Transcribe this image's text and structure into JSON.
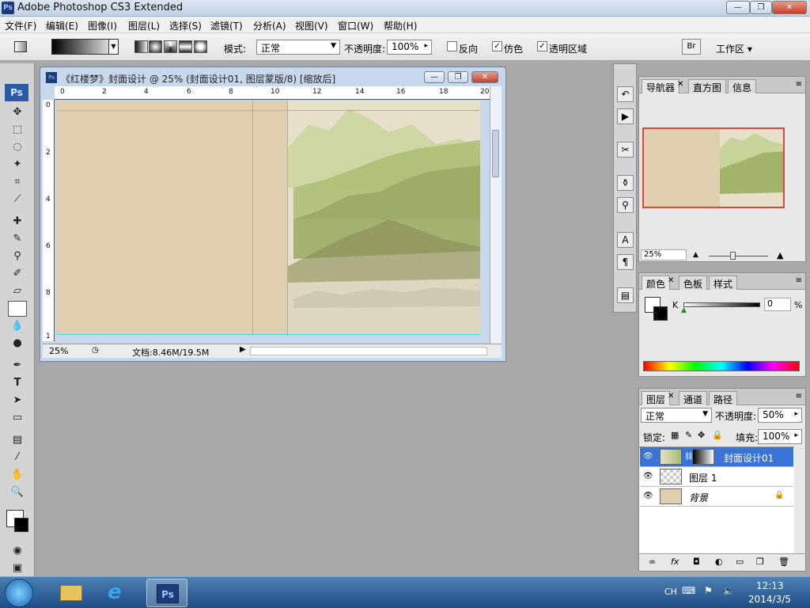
{
  "app": {
    "title": "Adobe Photoshop CS3 Extended",
    "icon_text": "Ps"
  },
  "window_controls": {
    "minimize": "—",
    "maximize": "❐",
    "close": "✕"
  },
  "menu": [
    "文件(F)",
    "编辑(E)",
    "图像(I)",
    "图层(L)",
    "选择(S)",
    "滤镜(T)",
    "分析(A)",
    "视图(V)",
    "窗口(W)",
    "帮助(H)"
  ],
  "options": {
    "mode_label": "模式:",
    "mode_value": "正常",
    "opacity_label": "不透明度:",
    "opacity_value": "100%",
    "reverse_label": "反向",
    "reverse_checked": false,
    "dither_label": "仿色",
    "dither_checked": true,
    "transparency_label": "透明区域",
    "transparency_checked": true,
    "workspace_label": "工作区 ▾"
  },
  "document": {
    "title": "《红楼梦》封面设计 @ 25% (封面设计01, 图层蒙版/8) [缩放后]",
    "zoom": "25%",
    "doc_info": "文档:8.46M/19.5M",
    "ruler_h": [
      "0",
      "2",
      "4",
      "6",
      "8",
      "10",
      "12",
      "14",
      "16",
      "18",
      "20"
    ],
    "ruler_v": [
      "0",
      "2",
      "4",
      "6",
      "8",
      "1"
    ]
  },
  "navigator": {
    "tabs": [
      "导航器",
      "直方图",
      "信息"
    ],
    "zoom": "25%"
  },
  "color_panel": {
    "tabs": [
      "颜色",
      "色板",
      "样式"
    ],
    "channel_label": "K",
    "value": "0",
    "unit": "%"
  },
  "layers_panel": {
    "tabs": [
      "图层",
      "通道",
      "路径"
    ],
    "blend_mode": "正常",
    "opacity_label": "不透明度:",
    "opacity_value": "50%",
    "lock_label": "锁定:",
    "fill_label": "填充:",
    "fill_value": "100%",
    "layers": [
      {
        "name": "封面设计01",
        "active": true
      },
      {
        "name": "图层 1",
        "active": false
      },
      {
        "name": "背景",
        "active": false
      }
    ]
  },
  "taskbar": {
    "lang": "CH",
    "time": "12:13",
    "date": "2014/3/5",
    "ps_label": "Ps"
  },
  "colors": {
    "accent_selection": "#3874d8",
    "guide": "#38e0e0",
    "canvas_paper": "#e0cfae"
  }
}
